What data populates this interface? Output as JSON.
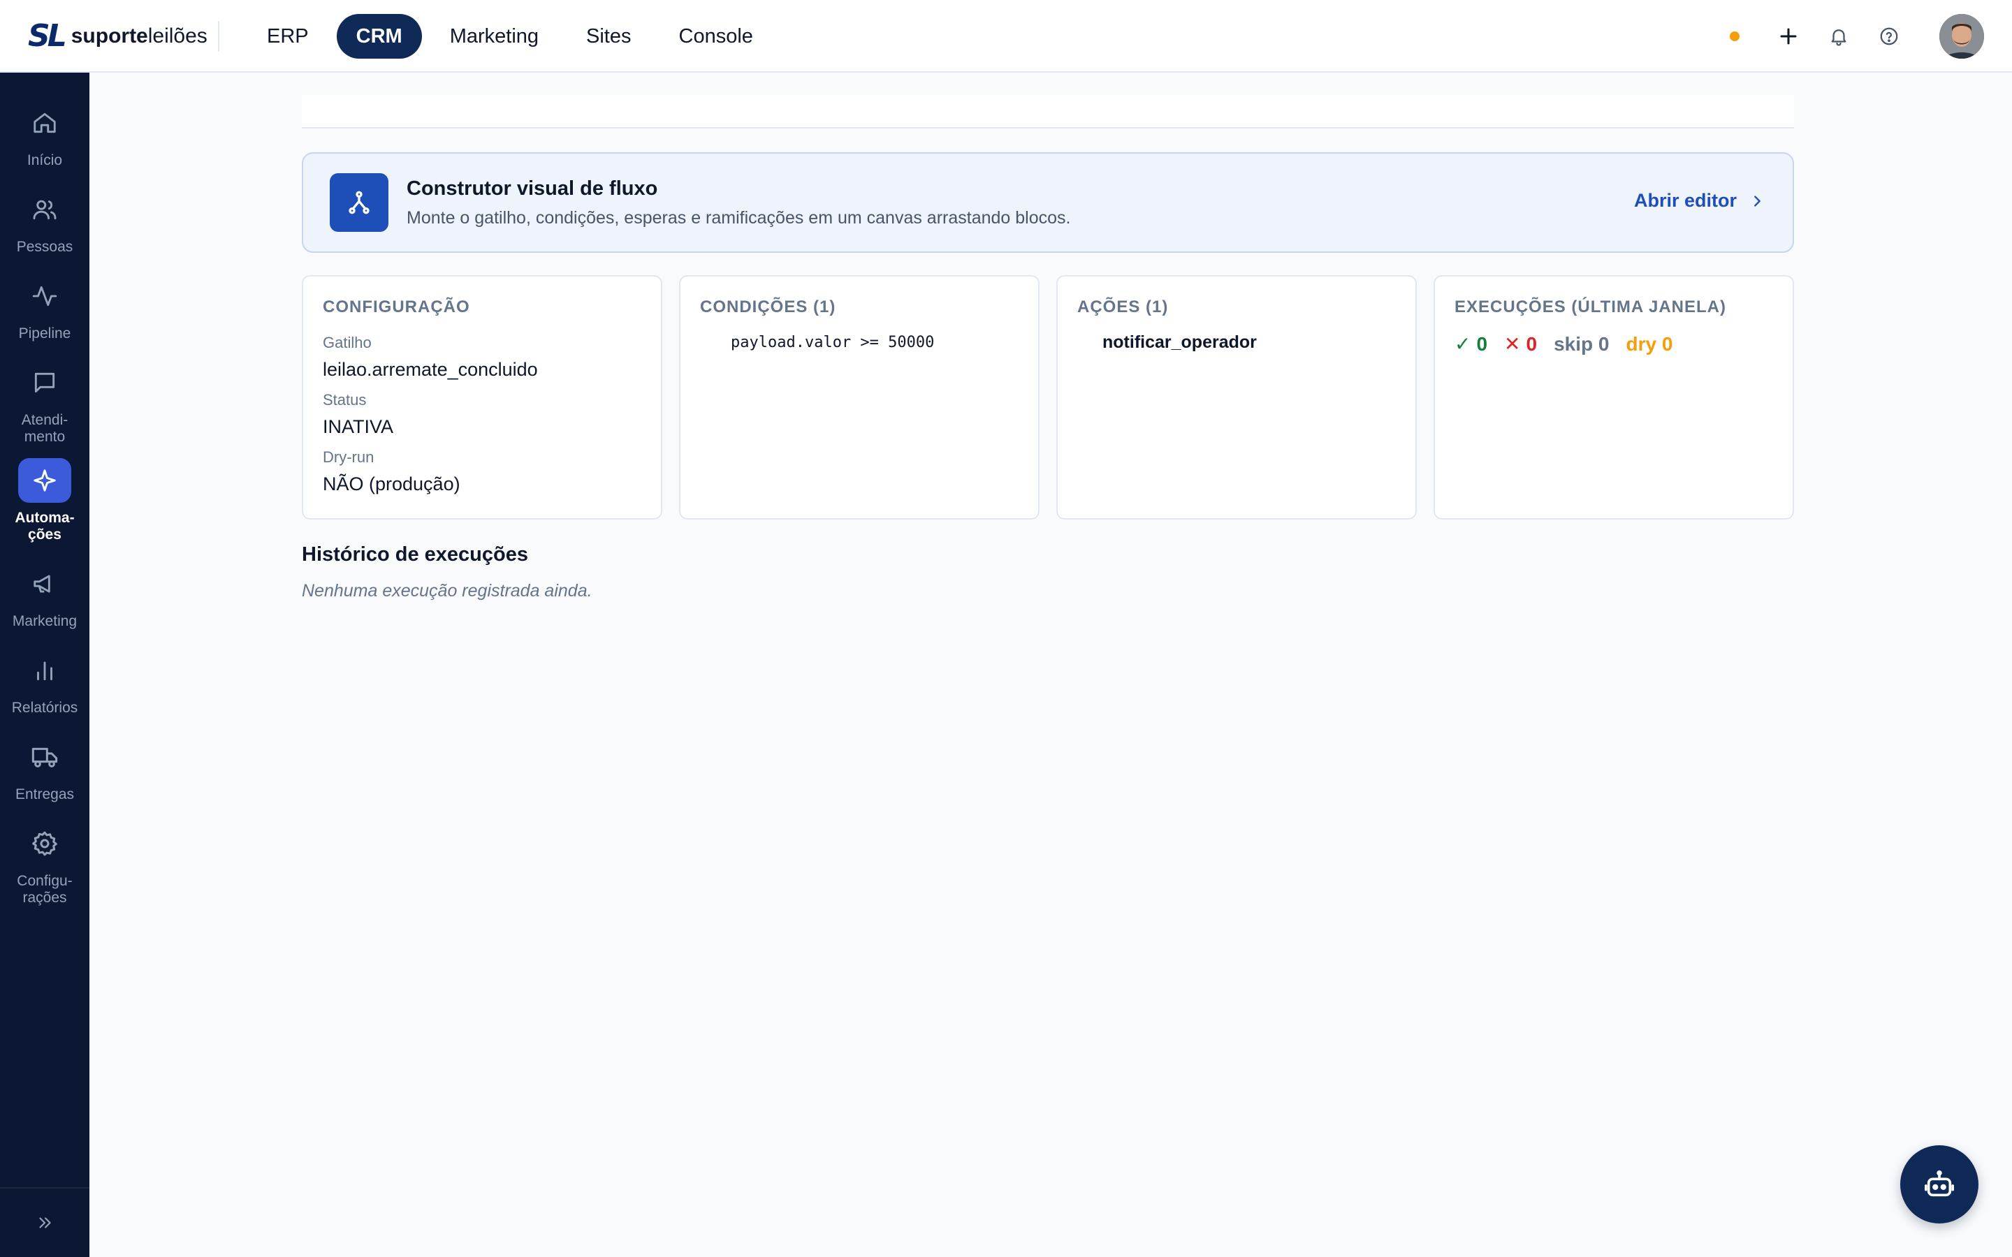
{
  "brand": {
    "mark": "SL",
    "name_bold": "suporte",
    "name_light": "leilões"
  },
  "topnav": [
    {
      "label": "ERP",
      "active": false
    },
    {
      "label": "CRM",
      "active": true
    },
    {
      "label": "Marketing",
      "active": false
    },
    {
      "label": "Sites",
      "active": false
    },
    {
      "label": "Console",
      "active": false
    }
  ],
  "colors": {
    "accent": "#1e4fb8",
    "nav_active": "#0f2a57",
    "sidebar_bg": "#0b1733",
    "status_dot": "#f59e0b"
  },
  "sidebar": {
    "items": [
      {
        "label": "Início",
        "icon": "home-icon"
      },
      {
        "label": "Pessoas",
        "icon": "users-icon"
      },
      {
        "label": "Pipeline",
        "icon": "activity-icon"
      },
      {
        "label": "Atendi-\nmento",
        "icon": "message-icon"
      },
      {
        "label": "Automa-\nções",
        "icon": "sparkle-icon",
        "active": true
      },
      {
        "label": "Marketing",
        "icon": "megaphone-icon"
      },
      {
        "label": "Relatórios",
        "icon": "bar-chart-icon"
      },
      {
        "label": "Entregas",
        "icon": "truck-icon"
      },
      {
        "label": "Configu-\nrações",
        "icon": "gear-icon"
      }
    ]
  },
  "builder": {
    "title": "Construtor visual de fluxo",
    "subtitle": "Monte o gatilho, condições, esperas e ramificações em um canvas arrastando blocos.",
    "link": "Abrir editor"
  },
  "config": {
    "title": "CONFIGURAÇÃO",
    "trigger_label": "Gatilho",
    "trigger_value": "leilao.arremate_concluido",
    "status_label": "Status",
    "status_value": "INATIVA",
    "dryrun_label": "Dry-run",
    "dryrun_value": "NÃO (produção)"
  },
  "conditions": {
    "title": "CONDIÇÕES (1)",
    "items": [
      "payload.valor >= 50000"
    ]
  },
  "actions": {
    "title": "AÇÕES (1)",
    "items": [
      "notificar_operador"
    ]
  },
  "executions": {
    "title": "EXECUÇÕES (ÚLTIMA JANELA)",
    "ok_symbol": "✓",
    "ok": "0",
    "err_symbol": "✕",
    "err": "0",
    "skip": "skip 0",
    "dry": "dry 0"
  },
  "history": {
    "title": "Histórico de execuções",
    "empty": "Nenhuma execução registrada ainda."
  }
}
